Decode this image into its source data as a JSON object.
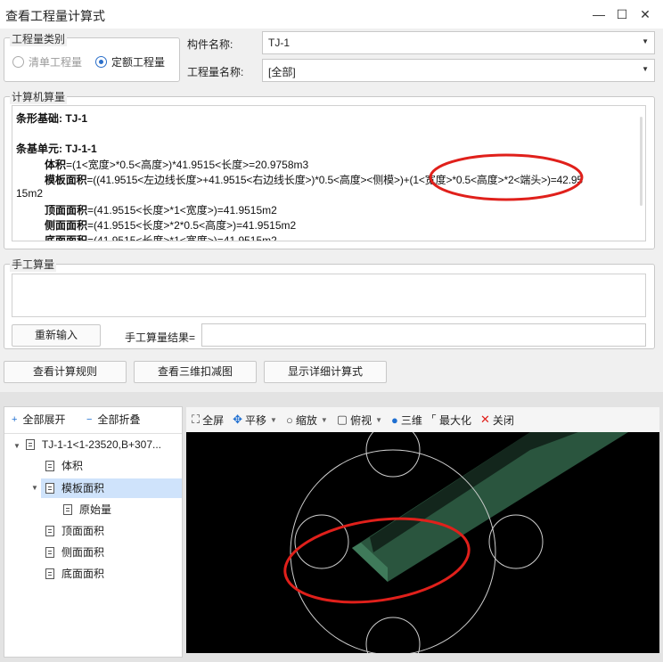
{
  "window": {
    "title": "查看工程量计算式",
    "minimize_glyph": "—",
    "maximize_glyph": "☐",
    "close_glyph": "✕"
  },
  "category": {
    "legend": "工程量类别",
    "option_list": "清单工程量",
    "option_quota": "定额工程量",
    "selected": "定额工程量"
  },
  "fields": {
    "component_label": "构件名称:",
    "component_value": "TJ-1",
    "quantity_label": "工程量名称:",
    "quantity_value": "[全部]"
  },
  "computer": {
    "legend": "计算机算量",
    "lines": [
      {
        "bold": "条形基础: TJ-1",
        "text": ""
      },
      {
        "bold": "条基单元: TJ-1-1",
        "text": ""
      },
      {
        "bold": "体积",
        "text": "=(1<宽度>*0.5<高度>)*41.9515<长度>=20.9758m3"
      },
      {
        "bold": "模板面积",
        "text": "=((41.9515<左边线长度>+41.9515<右边线长度>)*0.5<高度><侧模>)+(1<宽度>*0.5<高度>*2<端头>)=42.95"
      },
      {
        "bold": "",
        "text": "15m2"
      },
      {
        "bold": "顶面面积",
        "text": "=(41.9515<长度>*1<宽度>)=41.9515m2"
      },
      {
        "bold": "侧面面积",
        "text": "=(41.9515<长度>*2*0.5<高度>)=41.9515m2"
      },
      {
        "bold": "底面面积",
        "text": "=(41.9515<长度>*1<宽度>)=41.9515m2"
      }
    ]
  },
  "manual": {
    "legend": "手工算量",
    "reenter_button": "重新输入",
    "result_label": "手工算量结果="
  },
  "actions": {
    "view_rules": "查看计算规则",
    "view_3d": "查看三维扣减图",
    "show_detail": "显示详细计算式"
  },
  "tree": {
    "expand_all": "全部展开",
    "collapse_all": "全部折叠",
    "root": "TJ-1-1<1-23520,B+307...",
    "items": [
      "体积",
      "模板面积",
      "原始量",
      "顶面面积",
      "侧面面积",
      "底面面积"
    ],
    "selected": "模板面积"
  },
  "viewer_toolbar": {
    "fullscreen": "全屏",
    "pan": "平移",
    "zoom": "缩放",
    "top_view": "俯视",
    "three_d": "三维",
    "maximize": "最大化",
    "close": "关闭"
  },
  "colors": {
    "annotation_red": "#e0201b",
    "viewer_bg": "#000000",
    "beam_green": "#3f7a5a",
    "selected_row": "#cfe3fb",
    "accent_blue": "#2b6fc9"
  }
}
